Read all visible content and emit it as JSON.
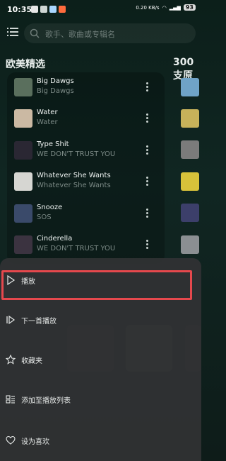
{
  "status": {
    "time": "10:35",
    "net": "0.20 KB/s",
    "battery": "93"
  },
  "search": {
    "placeholder": "歌手、歌曲或专辑名"
  },
  "sections": {
    "left_title": "欧美精选",
    "right_title": "300支原"
  },
  "songs": [
    {
      "title": "Big Dawgs",
      "subtitle": "Big Dawgs",
      "cover": "#5a6f5d"
    },
    {
      "title": "Water",
      "subtitle": "Water",
      "cover": "#cbb9a3"
    },
    {
      "title": "Type Shit",
      "subtitle": "WE DON'T TRUST YOU",
      "cover": "#2a2733"
    },
    {
      "title": "Whatever She Wants",
      "subtitle": "Whatever She Wants",
      "cover": "#d6d6d2"
    },
    {
      "title": "Snooze",
      "subtitle": "SOS",
      "cover": "#3a4a6a"
    },
    {
      "title": "Cinderella",
      "subtitle": "WE DON'T TRUST YOU",
      "cover": "#3b3340"
    }
  ],
  "sheet": {
    "options": [
      {
        "label": "播放",
        "icon": "play-icon"
      },
      {
        "label": "下一首播放",
        "icon": "play-next-icon"
      },
      {
        "label": "收藏夹",
        "icon": "star-icon"
      },
      {
        "label": "添加至播放列表",
        "icon": "add-to-playlist-icon"
      },
      {
        "label": "设为喜欢",
        "icon": "heart-icon"
      }
    ]
  },
  "colors": {
    "accent": "#e5484d",
    "sheet_bg": "#303234"
  }
}
